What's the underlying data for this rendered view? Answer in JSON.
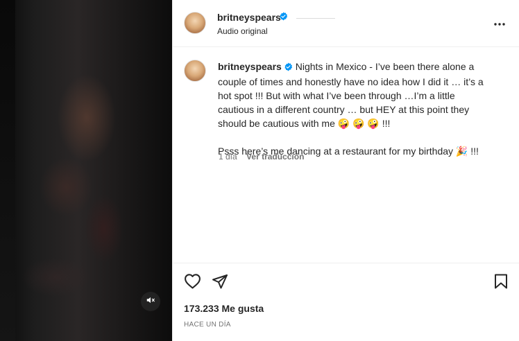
{
  "header": {
    "username": "britneyspears",
    "audio_label": "Audio original",
    "more_icon": "more-horizontal-icon"
  },
  "caption": {
    "username": "britneyspears",
    "text": "Nights in Mexico - I’ve been there alone a couple of times and honestly have no idea how I did it … it’s a hot spot !!! But with what I’ve been through …I’m a little cautious in a different country … but HEY at this point they should be cautious with me 🤪 🤪 🤪 !!!\n\nPsss here’s me dancing at a restaurant for my birthday 🎉 !!!",
    "time_ago": "1 día",
    "translate_label": "Ver traducción"
  },
  "actions": {
    "icons": [
      "heart-icon",
      "share-icon",
      "bookmark-icon"
    ]
  },
  "likes": {
    "label": "173.233 Me gusta"
  },
  "post_date": {
    "label": "HACE UN DÍA"
  },
  "video": {
    "mute_icon": "muted-speaker-icon"
  },
  "colors": {
    "verified": "#0095f6",
    "text_primary": "#262626",
    "text_secondary": "#737373",
    "divider": "#efefef"
  }
}
